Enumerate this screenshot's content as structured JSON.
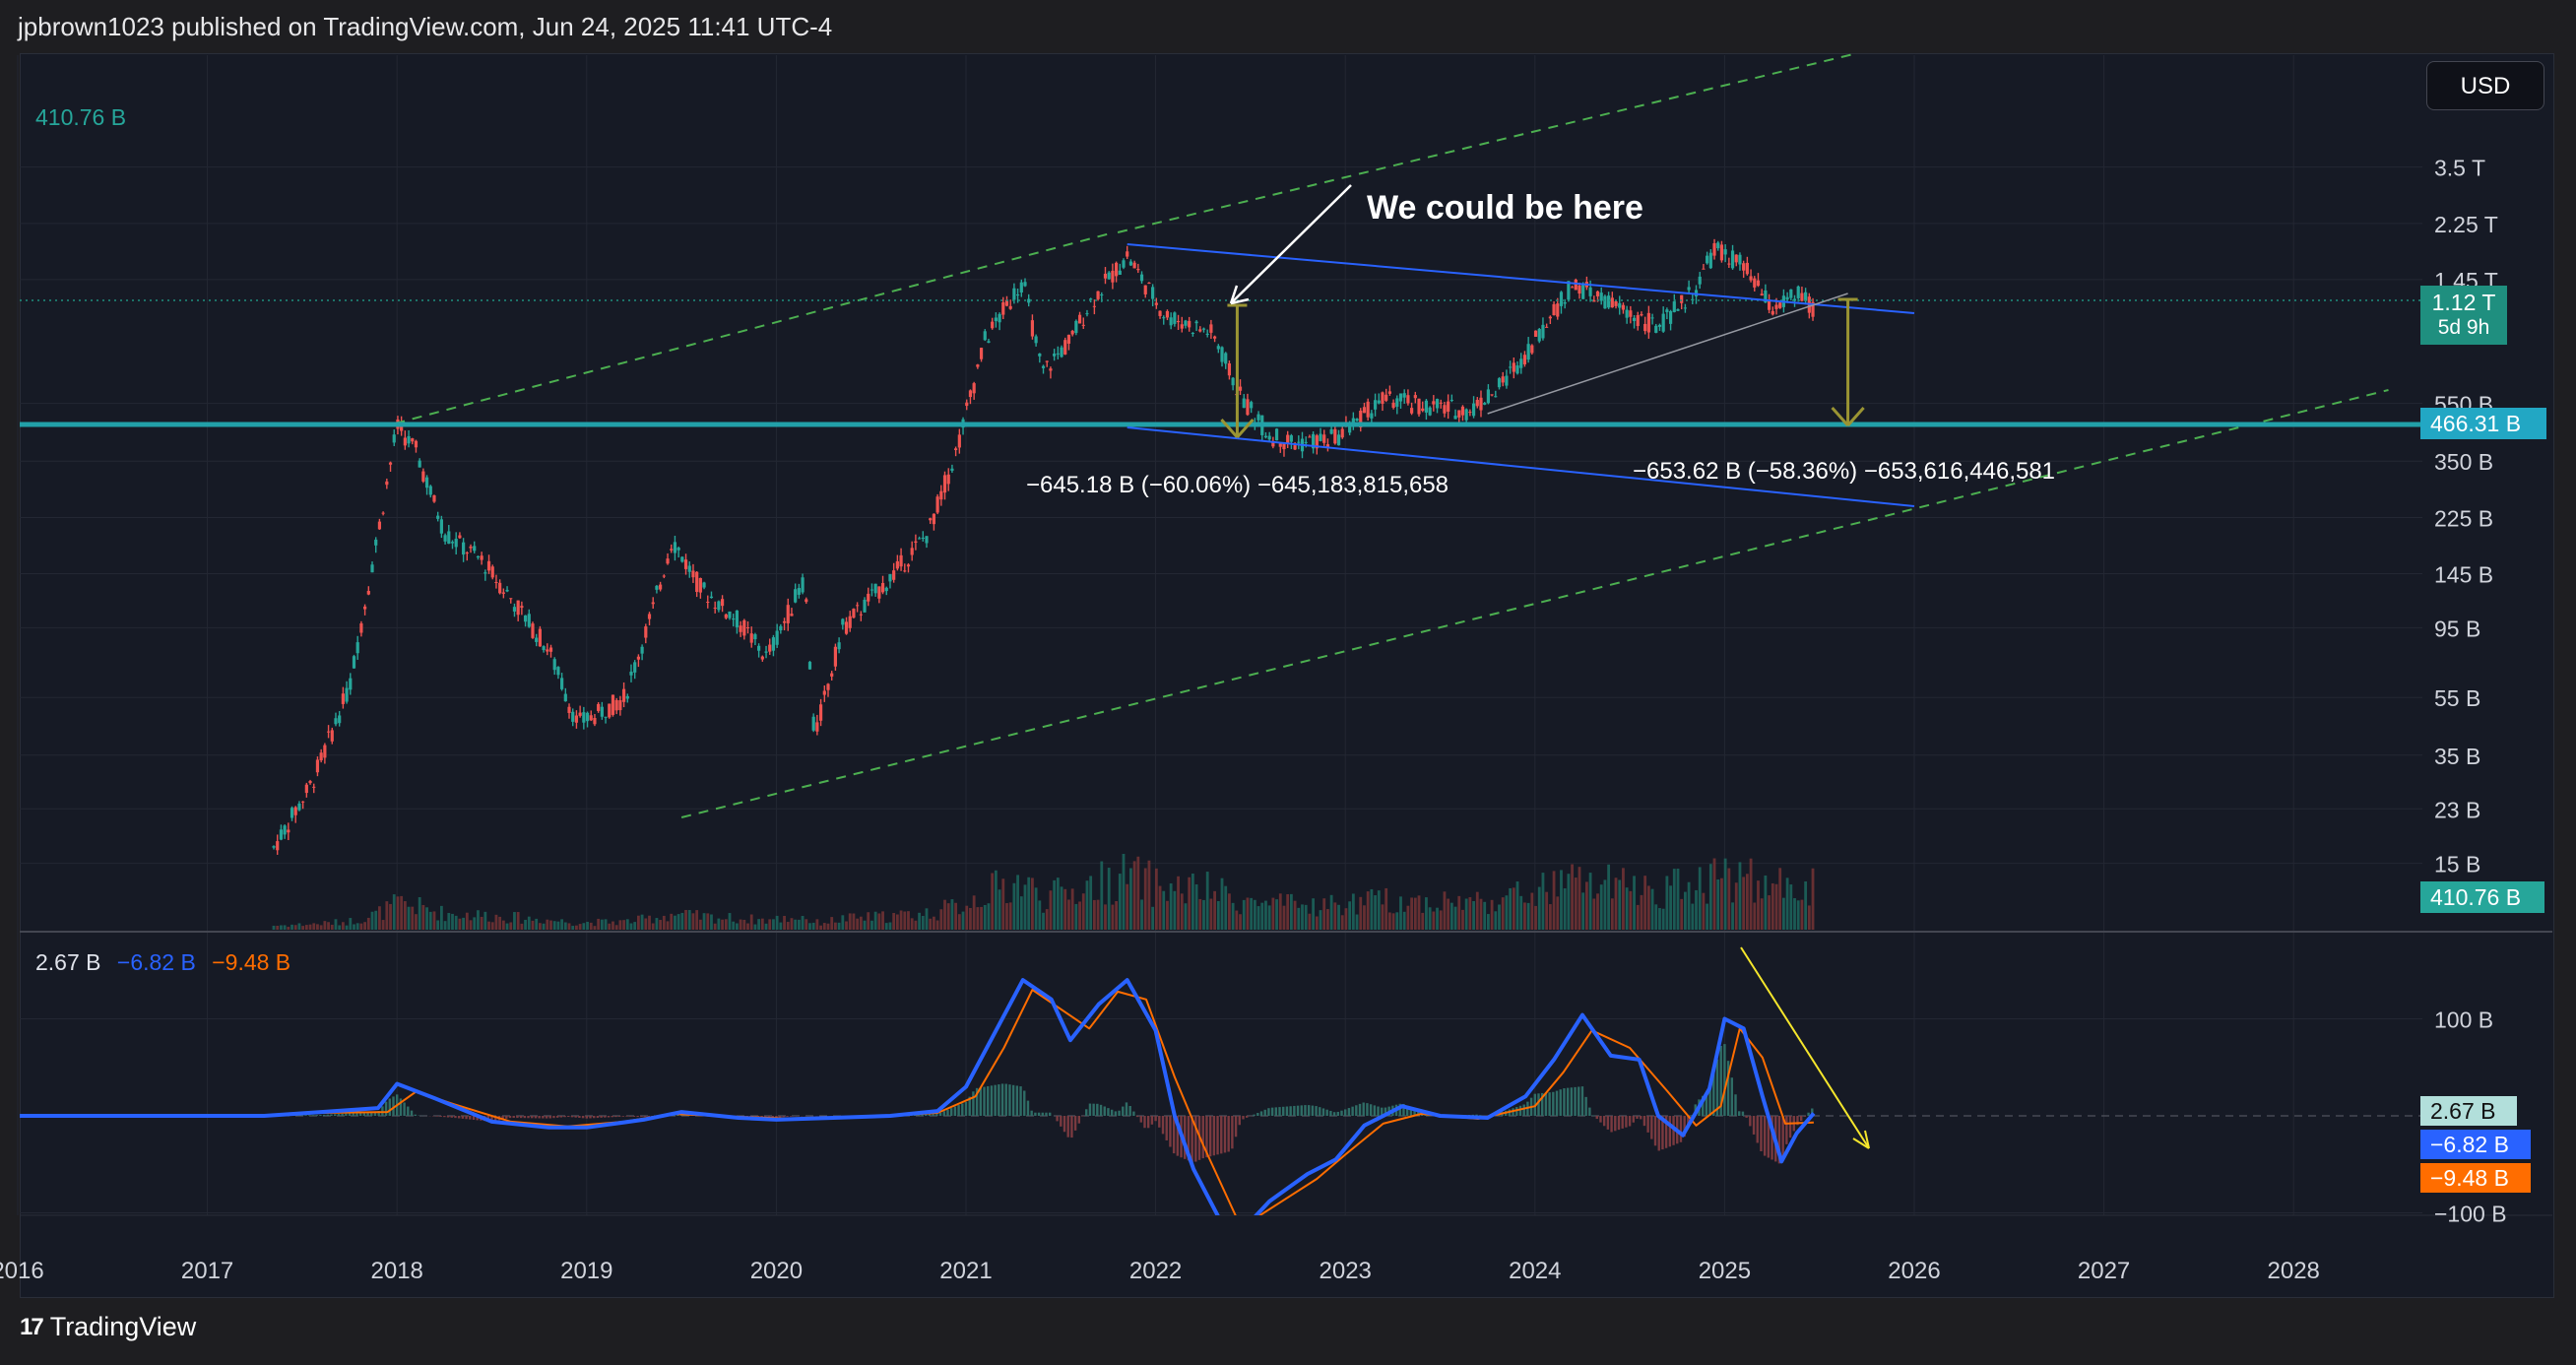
{
  "header": {
    "title": "jpbrown1023 published on TradingView.com, Jun 24, 2025 11:41 UTC-4"
  },
  "currency_button": "USD",
  "volume_legend": "410.76 B",
  "macd_legend": {
    "macd": "2.67 B",
    "signal": "−6.82 B",
    "hist": "−9.48 B"
  },
  "branding": {
    "logo_mark": "17",
    "name": "TradingView"
  },
  "price_tags": {
    "last_price": "1.12 T",
    "countdown": "5d 9h",
    "support": "466.31 B",
    "volume": "410.76 B",
    "macd": "2.67 B",
    "signal": "−6.82 B",
    "histogram": "−9.48 B"
  },
  "annotations": {
    "callout": "We could be here",
    "measure_1": "−645.18 B (−60.06%) −645,183,815,658",
    "measure_2": "−653.62 B (−58.36%) −653,616,446,581"
  },
  "colors": {
    "up": "#26a69a",
    "down": "#ef5350",
    "channel": "#4caf50",
    "wedge": "#2962ff",
    "support": "#22a0a8",
    "macd": "#2962ff",
    "signal": "#ff6d00",
    "arrow": "#9a9433",
    "trend": "#f5e62c"
  },
  "chart_data": [
    {
      "type": "candlestick",
      "title": "",
      "x_ticks": [
        "2016",
        "2017",
        "2018",
        "2019",
        "2020",
        "2021",
        "2022",
        "2023",
        "2024",
        "2025",
        "2026",
        "2027",
        "2028"
      ],
      "y_scale": "log",
      "y_ticks": [
        "3.5 T",
        "2.25 T",
        "1.45 T",
        "550 B",
        "350 B",
        "225 B",
        "145 B",
        "95 B",
        "55 B",
        "35 B",
        "23 B",
        "15 B"
      ],
      "close_path": [
        [
          2017.35,
          17
        ],
        [
          2017.55,
          28
        ],
        [
          2017.75,
          60
        ],
        [
          2017.9,
          200
        ],
        [
          2018.0,
          460
        ],
        [
          2018.1,
          380
        ],
        [
          2018.25,
          200
        ],
        [
          2018.45,
          160
        ],
        [
          2018.6,
          120
        ],
        [
          2018.8,
          80
        ],
        [
          2018.95,
          45
        ],
        [
          2019.05,
          48
        ],
        [
          2019.2,
          55
        ],
        [
          2019.35,
          110
        ],
        [
          2019.45,
          190
        ],
        [
          2019.6,
          130
        ],
        [
          2019.8,
          100
        ],
        [
          2019.95,
          75
        ],
        [
          2020.15,
          140
        ],
        [
          2020.2,
          40
        ],
        [
          2020.35,
          95
        ],
        [
          2020.6,
          140
        ],
        [
          2020.8,
          200
        ],
        [
          2020.95,
          380
        ],
        [
          2021.1,
          900
        ],
        [
          2021.3,
          1450
        ],
        [
          2021.4,
          700
        ],
        [
          2021.55,
          900
        ],
        [
          2021.65,
          1200
        ],
        [
          2021.85,
          1750
        ],
        [
          2022.05,
          1100
        ],
        [
          2022.3,
          950
        ],
        [
          2022.45,
          580
        ],
        [
          2022.6,
          430
        ],
        [
          2022.75,
          400
        ],
        [
          2022.95,
          420
        ],
        [
          2023.2,
          570
        ],
        [
          2023.4,
          540
        ],
        [
          2023.65,
          520
        ],
        [
          2023.8,
          610
        ],
        [
          2024.0,
          900
        ],
        [
          2024.2,
          1400
        ],
        [
          2024.45,
          1150
        ],
        [
          2024.65,
          1000
        ],
        [
          2024.85,
          1350
        ],
        [
          2024.95,
          1850
        ],
        [
          2025.1,
          1600
        ],
        [
          2025.25,
          1150
        ],
        [
          2025.4,
          1300
        ],
        [
          2025.47,
          1120
        ]
      ],
      "levels": {
        "last_price_value": 1120000000000,
        "support_value": 466310000000
      },
      "volume_latest": 410760000000
    },
    {
      "type": "line",
      "title": "",
      "series_note": "MACD",
      "y_ticks": [
        "100 B",
        "−100 B"
      ],
      "macd_line": [
        [
          2016,
          0
        ],
        [
          2017.3,
          0
        ],
        [
          2017.6,
          4
        ],
        [
          2017.9,
          8
        ],
        [
          2018.0,
          33
        ],
        [
          2018.2,
          18
        ],
        [
          2018.5,
          -6
        ],
        [
          2018.8,
          -12
        ],
        [
          2019.0,
          -12
        ],
        [
          2019.3,
          -4
        ],
        [
          2019.5,
          4
        ],
        [
          2019.8,
          -2
        ],
        [
          2020.0,
          -4
        ],
        [
          2020.3,
          -2
        ],
        [
          2020.6,
          0
        ],
        [
          2020.85,
          5
        ],
        [
          2021.0,
          30
        ],
        [
          2021.15,
          85
        ],
        [
          2021.3,
          140
        ],
        [
          2021.45,
          120
        ],
        [
          2021.55,
          78
        ],
        [
          2021.7,
          115
        ],
        [
          2021.85,
          140
        ],
        [
          2022.0,
          88
        ],
        [
          2022.1,
          0
        ],
        [
          2022.2,
          -55
        ],
        [
          2022.4,
          -130
        ],
        [
          2022.6,
          -88
        ],
        [
          2022.8,
          -60
        ],
        [
          2022.95,
          -45
        ],
        [
          2023.1,
          -10
        ],
        [
          2023.3,
          10
        ],
        [
          2023.5,
          0
        ],
        [
          2023.75,
          -2
        ],
        [
          2023.95,
          20
        ],
        [
          2024.1,
          58
        ],
        [
          2024.25,
          104
        ],
        [
          2024.4,
          62
        ],
        [
          2024.55,
          58
        ],
        [
          2024.65,
          0
        ],
        [
          2024.78,
          -20
        ],
        [
          2024.92,
          28
        ],
        [
          2025.0,
          100
        ],
        [
          2025.1,
          90
        ],
        [
          2025.2,
          20
        ],
        [
          2025.3,
          -47
        ],
        [
          2025.38,
          -18
        ],
        [
          2025.47,
          2.67
        ]
      ],
      "signal_line": [
        [
          2016,
          0
        ],
        [
          2017.3,
          0
        ],
        [
          2017.6,
          3
        ],
        [
          2017.95,
          4
        ],
        [
          2018.1,
          25
        ],
        [
          2018.3,
          12
        ],
        [
          2018.6,
          -6
        ],
        [
          2018.9,
          -11
        ],
        [
          2019.2,
          -6
        ],
        [
          2019.45,
          2
        ],
        [
          2019.8,
          -1
        ],
        [
          2020.1,
          -3
        ],
        [
          2020.5,
          -1
        ],
        [
          2020.85,
          3
        ],
        [
          2021.05,
          20
        ],
        [
          2021.2,
          70
        ],
        [
          2021.35,
          130
        ],
        [
          2021.5,
          110
        ],
        [
          2021.65,
          90
        ],
        [
          2021.8,
          128
        ],
        [
          2021.95,
          120
        ],
        [
          2022.1,
          40
        ],
        [
          2022.25,
          -30
        ],
        [
          2022.45,
          -115
        ],
        [
          2022.65,
          -90
        ],
        [
          2022.85,
          -65
        ],
        [
          2023.0,
          -40
        ],
        [
          2023.2,
          -8
        ],
        [
          2023.4,
          2
        ],
        [
          2023.7,
          -3
        ],
        [
          2024.0,
          10
        ],
        [
          2024.15,
          45
        ],
        [
          2024.3,
          88
        ],
        [
          2024.5,
          70
        ],
        [
          2024.7,
          25
        ],
        [
          2024.85,
          -10
        ],
        [
          2024.98,
          10
        ],
        [
          2025.08,
          90
        ],
        [
          2025.2,
          60
        ],
        [
          2025.32,
          -8
        ],
        [
          2025.47,
          -6.82
        ]
      ],
      "histogram_latest": -9.48
    }
  ]
}
